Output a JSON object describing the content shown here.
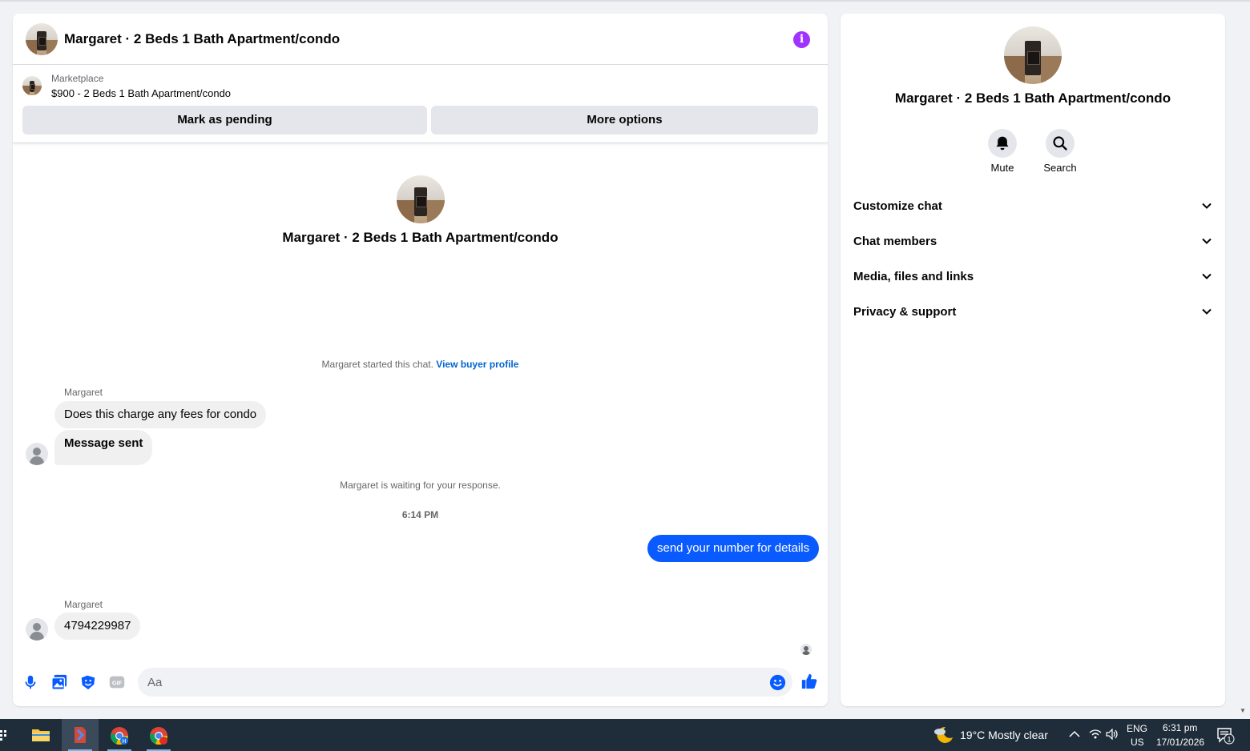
{
  "chat": {
    "title": "Margaret · 2 Beds 1 Bath Apartment/condo",
    "info_icon": "i"
  },
  "listing": {
    "source": "Marketplace",
    "price_title": "$900 - 2 Beds 1 Bath Apartment/condo",
    "mark_pending_label": "Mark as pending",
    "more_options_label": "More options"
  },
  "intro": {
    "title": "Margaret · 2 Beds 1 Bath Apartment/condo",
    "started_text": "Margaret started this chat. ",
    "view_profile_link": "View buyer profile"
  },
  "messages": {
    "sender1": "Margaret",
    "msg1": "Does this charge any fees for condo",
    "msg2": "Message sent",
    "waiting": "Margaret is waiting for your response.",
    "time": "6:14 PM",
    "outgoing": "send your number for details",
    "sender2": "Margaret",
    "msg3": "4794229987"
  },
  "composer": {
    "placeholder": "Aa",
    "icons": [
      "microphone-icon",
      "photo-icon",
      "sticker-icon",
      "gif-icon",
      "emoji-icon",
      "like-icon"
    ]
  },
  "side": {
    "title": "Margaret · 2 Beds 1 Bath Apartment/condo",
    "mute_label": "Mute",
    "search_label": "Search",
    "sections": [
      "Customize chat",
      "Chat members",
      "Media, files and links",
      "Privacy & support"
    ]
  },
  "taskbar": {
    "weather": "19°C  Mostly clear",
    "lang": "ENG",
    "region": "US",
    "time": "6:31 pm",
    "date": "17/01/2026",
    "notifications": "1"
  },
  "colors": {
    "accent_blue": "#0a5bff",
    "link_blue": "#0064d1",
    "info_purple": "#a033ff",
    "taskbar": "#1f2c3a"
  }
}
